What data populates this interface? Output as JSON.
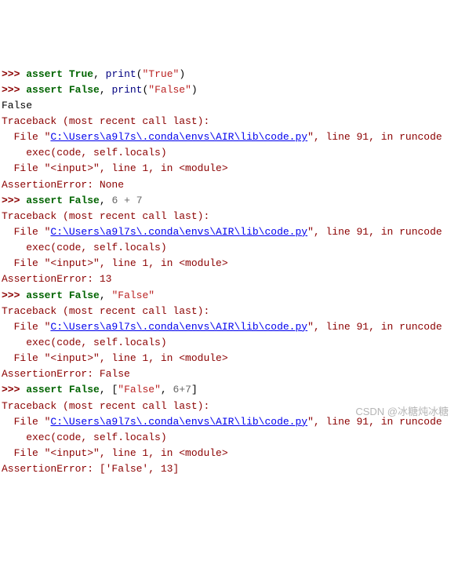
{
  "prompt": ">>>",
  "kw_assert": "assert",
  "bool_true": "True",
  "bool_false": "False",
  "func_print": "print",
  "str_true_lit": "\"True\"",
  "str_false_lit": "\"False\"",
  "comma_sp": ", ",
  "space": " ",
  "lparen": "(",
  "rparen": ")",
  "lbracket": "[",
  "rbracket": "]",
  "op_plus": "+",
  "num_6": "6",
  "num_7": "7",
  "out_false": "False",
  "tb_header": "Traceback (most recent call last):",
  "tb_file_prefix": "  File \"",
  "tb_path": "C:\\Users\\a9l7s\\.conda\\envs\\AIR\\lib\\code.py",
  "tb_file_suffix": "\", line 91, in runcode",
  "tb_exec": "    exec(code, self.locals)",
  "tb_input": "  File \"<input>\", line 1, in <module>",
  "ae_none": "AssertionError: None",
  "ae_13": "AssertionError: 13",
  "ae_false": "AssertionError: False",
  "ae_list": "AssertionError: ['False', 13]",
  "watermark": "CSDN @冰糖炖冰糖"
}
